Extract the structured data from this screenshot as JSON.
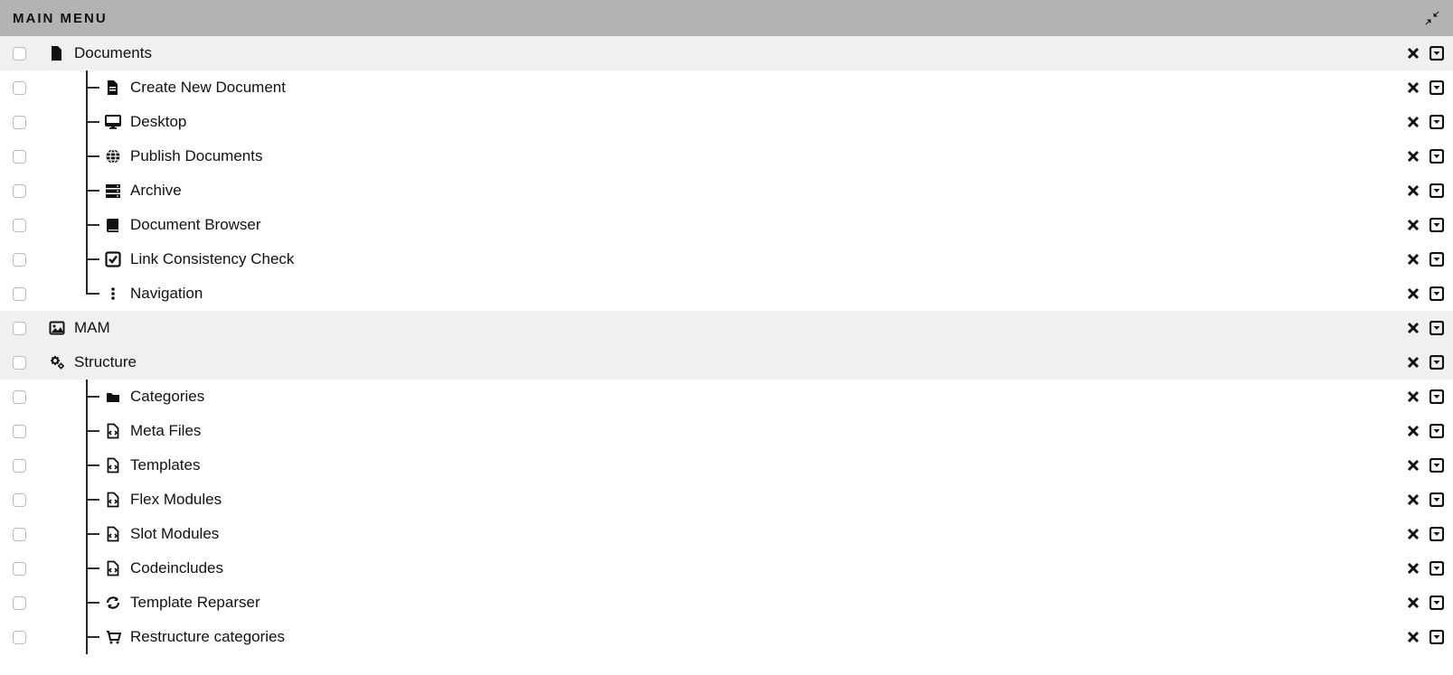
{
  "header": {
    "title": "MAIN MENU"
  },
  "items": [
    {
      "label": "Documents",
      "icon": "file-solid-icon",
      "top": true,
      "child": false,
      "last": false
    },
    {
      "label": "Create New Document",
      "icon": "file-lines-icon",
      "top": false,
      "child": true,
      "last": false
    },
    {
      "label": "Desktop",
      "icon": "desktop-icon",
      "top": false,
      "child": true,
      "last": false
    },
    {
      "label": "Publish Documents",
      "icon": "globe-icon",
      "top": false,
      "child": true,
      "last": false
    },
    {
      "label": "Archive",
      "icon": "server-icon",
      "top": false,
      "child": true,
      "last": false
    },
    {
      "label": "Document Browser",
      "icon": "book-icon",
      "top": false,
      "child": true,
      "last": false
    },
    {
      "label": "Link Consistency Check",
      "icon": "check-square-icon",
      "top": false,
      "child": true,
      "last": false
    },
    {
      "label": "Navigation",
      "icon": "dots-vertical-icon",
      "top": false,
      "child": true,
      "last": true
    },
    {
      "label": "MAM",
      "icon": "image-icon",
      "top": true,
      "child": false,
      "last": false
    },
    {
      "label": "Structure",
      "icon": "gears-icon",
      "top": true,
      "child": false,
      "last": false
    },
    {
      "label": "Categories",
      "icon": "folder-icon",
      "top": false,
      "child": true,
      "last": false
    },
    {
      "label": "Meta Files",
      "icon": "file-code-icon",
      "top": false,
      "child": true,
      "last": false
    },
    {
      "label": "Templates",
      "icon": "file-code-icon",
      "top": false,
      "child": true,
      "last": false
    },
    {
      "label": "Flex Modules",
      "icon": "file-code-icon",
      "top": false,
      "child": true,
      "last": false
    },
    {
      "label": "Slot Modules",
      "icon": "file-code-icon",
      "top": false,
      "child": true,
      "last": false
    },
    {
      "label": "Codeincludes",
      "icon": "file-code-icon",
      "top": false,
      "child": true,
      "last": false
    },
    {
      "label": "Template Reparser",
      "icon": "refresh-icon",
      "top": false,
      "child": true,
      "last": false
    },
    {
      "label": "Restructure categories",
      "icon": "cart-icon",
      "top": false,
      "child": true,
      "last": false
    }
  ]
}
